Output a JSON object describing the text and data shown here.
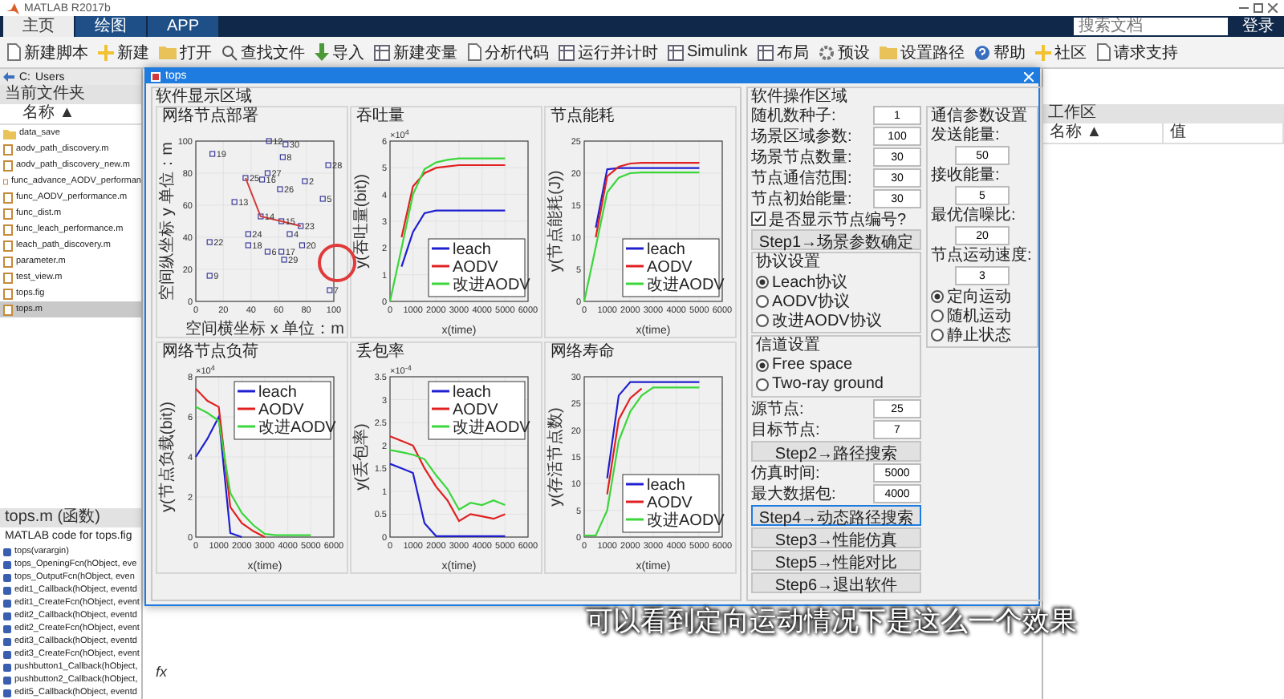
{
  "app": {
    "title": "MATLAB R2017b",
    "tabs": [
      {
        "label": "主页",
        "selected": true
      },
      {
        "label": "绘图",
        "selected": false
      },
      {
        "label": "APP",
        "selected": false
      }
    ],
    "search": {
      "placeholder": "搜索文档"
    },
    "login": "登录"
  },
  "toolbar": [
    {
      "label": "新建脚本",
      "kind": "doc"
    },
    {
      "label": "新建",
      "kind": "plus"
    },
    {
      "label": "打开",
      "kind": "folder"
    },
    {
      "label": "查找文件",
      "kind": "search"
    },
    {
      "label": "导入",
      "kind": "arrow"
    },
    {
      "label": "新建变量",
      "kind": "grid"
    },
    {
      "label": "分析代码",
      "kind": "doc"
    },
    {
      "label": "运行并计时",
      "kind": "grid"
    },
    {
      "label": "Simulink",
      "kind": "grid"
    },
    {
      "label": "布局",
      "kind": "grid"
    },
    {
      "label": "预设",
      "kind": "gear"
    },
    {
      "label": "设置路径",
      "kind": "folder"
    },
    {
      "label": "帮助",
      "kind": "help"
    },
    {
      "label": "社区",
      "kind": "plus"
    },
    {
      "label": "请求支持",
      "kind": "doc"
    }
  ],
  "folder": {
    "path": [
      "C:",
      "Users"
    ],
    "title": "当前文件夹",
    "column": "名称 ▲",
    "files": [
      {
        "name": "data_save",
        "kind": "folder",
        "selected": false
      },
      {
        "name": "aodv_path_discovery.m",
        "kind": "file",
        "selected": false
      },
      {
        "name": "aodv_path_discovery_new.m",
        "kind": "file",
        "selected": false
      },
      {
        "name": "func_advance_AODV_performan",
        "kind": "file",
        "selected": false
      },
      {
        "name": "func_AODV_performance.m",
        "kind": "file",
        "selected": false
      },
      {
        "name": "func_dist.m",
        "kind": "file",
        "selected": false
      },
      {
        "name": "func_leach_performance.m",
        "kind": "file",
        "selected": false
      },
      {
        "name": "leach_path_discovery.m",
        "kind": "file",
        "selected": false
      },
      {
        "name": "parameter.m",
        "kind": "file",
        "selected": false
      },
      {
        "name": "test_view.m",
        "kind": "file",
        "selected": false
      },
      {
        "name": "tops.fig",
        "kind": "file",
        "selected": false
      },
      {
        "name": "tops.m",
        "kind": "file",
        "selected": true
      }
    ]
  },
  "details": {
    "title": "tops.m (函数)",
    "description": "MATLAB code for tops.fig",
    "functions": [
      "tops(varargin)",
      "tops_OpeningFcn(hObject, eve",
      "tops_OutputFcn(hObject, even",
      "edit1_Callback(hObject, eventd",
      "edit1_CreateFcn(hObject, event",
      "edit2_Callback(hObject, eventd",
      "edit2_CreateFcn(hObject, event",
      "edit3_Callback(hObject, eventd",
      "edit3_CreateFcn(hObject, event",
      "pushbutton1_Callback(hObject,",
      "pushbutton2_Callback(hObject,",
      "edit5_Callback(hObject, eventd"
    ]
  },
  "workspace": {
    "title": "工作区",
    "columns": [
      "名称 ▲",
      "值"
    ]
  },
  "command": {
    "prompt": "fx"
  },
  "figure": {
    "title": "tops",
    "display": {
      "title": "软件显示区域",
      "charts": [
        {
          "title": "网络节点部署",
          "chart_data": {
            "type": "scatter",
            "grid": true,
            "xlabel": "空间横坐标 x 单位：m",
            "ylabel": "空间纵坐标 y 单位：m",
            "xlim": [
              0,
              100
            ],
            "ylim": [
              0,
              100
            ],
            "xticks": [
              0,
              20,
              40,
              60,
              80,
              100
            ],
            "yticks": [
              0,
              20,
              40,
              60,
              80,
              100
            ],
            "x": [
              12,
              36,
              48,
              52,
              63,
              65,
              53,
              96,
              79,
              61,
              28,
              92,
              47,
              62,
              76,
              68,
              38,
              38,
              77,
              10,
              52,
              62,
              64,
              10,
              97
            ],
            "series": [
              {
                "type": "scatter",
                "color": "#3b3b9a",
                "values": [
                  92,
                  77,
                  76,
                  80,
                  90,
                  98,
                  100,
                  85,
                  75,
                  70,
                  62,
                  64,
                  53,
                  50,
                  47,
                  42,
                  42,
                  35,
                  35,
                  37,
                  31,
                  31,
                  26,
                  16,
                  7
                ]
              },
              {
                "type": "line",
                "color": "#d23a3a",
                "values": [
                  null,
                  77,
                  null,
                  null,
                  null,
                  null,
                  null,
                  null,
                  null,
                  null,
                  null,
                  null,
                  53,
                  50,
                  47,
                  null,
                  null,
                  null,
                  null,
                  null,
                  null,
                  null,
                  null,
                  null,
                  null
                ]
              }
            ],
            "annotations": [
              "19",
              "25",
              "16",
              "27",
              "8",
              "30",
              "12",
              "28",
              "2",
              "26",
              "13",
              "5",
              "14",
              "15",
              "23",
              "4",
              "24",
              "18",
              "20",
              "22",
              "6",
              "17",
              "29",
              "9",
              "7"
            ]
          }
        },
        {
          "title": "吞吐量",
          "y_multiplier": {
            "base": "×10",
            "exp": "4"
          },
          "chart_data": {
            "type": "line",
            "grid": true,
            "legend": true,
            "xlabel": "x(time)",
            "ylabel": "y(吞吐量(bit))",
            "xlim": [
              0,
              6000
            ],
            "ylim": [
              0,
              6
            ],
            "xticks": [
              0,
              1000,
              2000,
              3000,
              4000,
              5000,
              6000
            ],
            "yticks": [
              0,
              1,
              2,
              3,
              4,
              5,
              6
            ],
            "x": [
              0,
              500,
              1000,
              1500,
              2000,
              2500,
              3000,
              3500,
              4000,
              4500,
              5000
            ],
            "series": [
              {
                "name": "leach",
                "color": "#1f1fd0",
                "values": [
                  null,
                  1.3,
                  2.6,
                  3.3,
                  3.4,
                  3.4,
                  3.4,
                  3.4,
                  3.4,
                  3.4,
                  3.4
                ]
              },
              {
                "name": "AODV",
                "color": "#e02020",
                "values": [
                  null,
                  2.4,
                  4.3,
                  4.8,
                  5.0,
                  5.05,
                  5.1,
                  5.1,
                  5.1,
                  5.1,
                  5.1
                ]
              },
              {
                "name": "改进AODV",
                "color": "#3ad63a",
                "values": [
                  0,
                  2.0,
                  4.0,
                  4.95,
                  5.2,
                  5.3,
                  5.35,
                  5.35,
                  5.35,
                  5.35,
                  5.35
                ]
              }
            ]
          }
        },
        {
          "title": "节点能耗",
          "chart_data": {
            "type": "line",
            "grid": true,
            "legend": true,
            "xlabel": "x(time)",
            "ylabel": "y(节点能耗(J))",
            "xlim": [
              0,
              6000
            ],
            "ylim": [
              0,
              25
            ],
            "xticks": [
              0,
              1000,
              2000,
              3000,
              4000,
              5000,
              6000
            ],
            "yticks": [
              0,
              5,
              10,
              15,
              20,
              25
            ],
            "x": [
              0,
              500,
              1000,
              1500,
              2000,
              2500,
              3000,
              3500,
              4000,
              4500,
              5000
            ],
            "series": [
              {
                "name": "leach",
                "color": "#1f1fd0",
                "values": [
                  null,
                  11.5,
                  20.6,
                  20.8,
                  20.8,
                  20.8,
                  20.8,
                  20.8,
                  20.8,
                  20.8,
                  20.8
                ]
              },
              {
                "name": "AODV",
                "color": "#e02020",
                "values": [
                  null,
                  10,
                  19.5,
                  21,
                  21.5,
                  21.6,
                  21.6,
                  21.6,
                  21.6,
                  21.6,
                  21.6
                ]
              },
              {
                "name": "改进AODV",
                "color": "#3ad63a",
                "values": [
                  0,
                  8.5,
                  17,
                  19.3,
                  20,
                  20.1,
                  20.1,
                  20.1,
                  20.1,
                  20.1,
                  20.1
                ]
              }
            ]
          }
        },
        {
          "title": "网络节点负荷",
          "y_multiplier": {
            "base": "×10",
            "exp": "4"
          },
          "chart_data": {
            "type": "line",
            "grid": true,
            "legend": true,
            "xlabel": "x(time)",
            "ylabel": "y(节点负载(bit))",
            "xlim": [
              0,
              6000
            ],
            "ylim": [
              0,
              8
            ],
            "xticks": [
              0,
              1000,
              2000,
              3000,
              4000,
              5000,
              6000
            ],
            "yticks": [
              0,
              2,
              4,
              6,
              8
            ],
            "x": [
              0,
              500,
              1000,
              1500,
              2000,
              2500,
              3000,
              3500,
              4000,
              4500,
              5000
            ],
            "series": [
              {
                "name": "leach",
                "color": "#1f1fd0",
                "values": [
                  4,
                  4.9,
                  6,
                  0.2,
                  0,
                  null,
                  null,
                  null,
                  null,
                  null,
                  null
                ]
              },
              {
                "name": "AODV",
                "color": "#e02020",
                "values": [
                  7.4,
                  6.8,
                  6.5,
                  1.5,
                  0.7,
                  0.3,
                  0,
                  null,
                  null,
                  null,
                  null
                ]
              },
              {
                "name": "改进AODV",
                "color": "#3ad63a",
                "values": [
                  6.5,
                  6.2,
                  5.8,
                  2.2,
                  1.2,
                  0.6,
                  0.15,
                  0.1,
                  0.1,
                  0.1,
                  0.1
                ]
              }
            ]
          }
        },
        {
          "title": "丢包率",
          "y_multiplier": {
            "base": "×10",
            "exp": "-4"
          },
          "chart_data": {
            "type": "line",
            "grid": true,
            "legend": true,
            "xlabel": "x(time)",
            "ylabel": "y(丢包率)",
            "xlim": [
              0,
              6000
            ],
            "ylim": [
              0,
              3.5
            ],
            "xticks": [
              0,
              1000,
              2000,
              3000,
              4000,
              5000,
              6000
            ],
            "yticks": [
              0,
              0.5,
              1,
              1.5,
              2,
              2.5,
              3,
              3.5
            ],
            "x": [
              0,
              500,
              1000,
              1500,
              2000,
              2500,
              3000,
              3500,
              4000,
              4500,
              5000
            ],
            "series": [
              {
                "name": "leach",
                "color": "#1f1fd0",
                "values": [
                  1.6,
                  1.5,
                  1.4,
                  0.3,
                  0.02,
                  0.02,
                  0.02,
                  0.02,
                  0.02,
                  0.02,
                  0.02
                ]
              },
              {
                "name": "AODV",
                "color": "#e02020",
                "values": [
                  2.2,
                  2.1,
                  2.0,
                  1.5,
                  1.1,
                  0.8,
                  0.35,
                  0.5,
                  0.45,
                  0.4,
                  0.5
                ]
              },
              {
                "name": "改进AODV",
                "color": "#3ad63a",
                "values": [
                  1.9,
                  1.85,
                  1.8,
                  1.7,
                  1.35,
                  1.05,
                  0.6,
                  0.75,
                  0.7,
                  0.8,
                  0.7
                ]
              }
            ]
          }
        },
        {
          "title": "网络寿命",
          "chart_data": {
            "type": "line",
            "grid": true,
            "legend": true,
            "xlabel": "x(time)",
            "ylabel": "y(存活节点数)",
            "xlim": [
              0,
              6000
            ],
            "ylim": [
              0,
              30
            ],
            "xticks": [
              0,
              1000,
              2000,
              3000,
              4000,
              5000,
              6000
            ],
            "yticks": [
              0,
              5,
              10,
              15,
              20,
              25,
              30
            ],
            "x": [
              0,
              500,
              1000,
              1500,
              2000,
              2500,
              3000,
              3500,
              4000,
              4500,
              5000
            ],
            "series": [
              {
                "name": "leach",
                "color": "#1f1fd0",
                "values": [
                  null,
                  null,
                  11,
                  26.5,
                  29,
                  29,
                  29,
                  29,
                  29,
                  29,
                  29
                ]
              },
              {
                "name": "AODV",
                "color": "#e02020",
                "values": [
                  null,
                  null,
                  8,
                  22,
                  26,
                  27.8,
                  null,
                  null,
                  null,
                  null,
                  null
                ]
              },
              {
                "name": "改进AODV",
                "color": "#3ad63a",
                "values": [
                  0.3,
                  0.3,
                  5,
                  18,
                  23.5,
                  26.5,
                  28,
                  28,
                  28,
                  28,
                  28
                ]
              }
            ]
          }
        }
      ]
    },
    "controls": {
      "title": "软件操作区域",
      "fields": [
        {
          "label": "随机数种子:",
          "value": "1"
        },
        {
          "label": "场景区域参数:",
          "value": "100"
        },
        {
          "label": "场景节点数量:",
          "value": "30"
        },
        {
          "label": "节点通信范围:",
          "value": "30"
        },
        {
          "label": "节点初始能量:",
          "value": "30"
        }
      ],
      "show_numbers": {
        "label": "是否显示节点编号?",
        "checked": true
      },
      "step1": "Step1→场景参数确定",
      "protocol": {
        "title": "协议设置",
        "options": [
          {
            "label": "Leach协议",
            "selected": true
          },
          {
            "label": "AODV协议",
            "selected": false
          },
          {
            "label": "改进AODV协议",
            "selected": false
          }
        ]
      },
      "comm": {
        "title": "通信参数设置",
        "fields": [
          {
            "label": "发送能量:",
            "value": "50"
          },
          {
            "label": "接收能量:",
            "value": "5"
          },
          {
            "label": "最优信噪比:",
            "value": "20"
          },
          {
            "label": "节点运动速度:",
            "value": "3"
          }
        ],
        "motion": [
          {
            "label": "定向运动",
            "selected": true
          },
          {
            "label": "随机运动",
            "selected": false
          },
          {
            "label": "静止状态",
            "selected": false
          }
        ]
      },
      "channel": {
        "title": "信道设置",
        "options": [
          {
            "label": "Free space",
            "selected": true
          },
          {
            "label": "Two-ray ground",
            "selected": false
          }
        ]
      },
      "route_fields": [
        {
          "label": "源节点:",
          "value": "25"
        },
        {
          "label": "目标节点:",
          "value": "7"
        }
      ],
      "step2": "Step2→路径搜索",
      "sim_fields": [
        {
          "label": "仿真时间:",
          "value": "5000"
        },
        {
          "label": "最大数据包:",
          "value": "4000"
        }
      ],
      "buttons": [
        {
          "label": "Step4→动态路径搜索",
          "selected": true
        },
        {
          "label": "Step3→性能仿真",
          "selected": false
        },
        {
          "label": "Step5→性能对比",
          "selected": false
        },
        {
          "label": "Step6→退出软件",
          "selected": false
        }
      ]
    }
  },
  "subtitle": "可以看到定向运动情况下是这么一个效果"
}
